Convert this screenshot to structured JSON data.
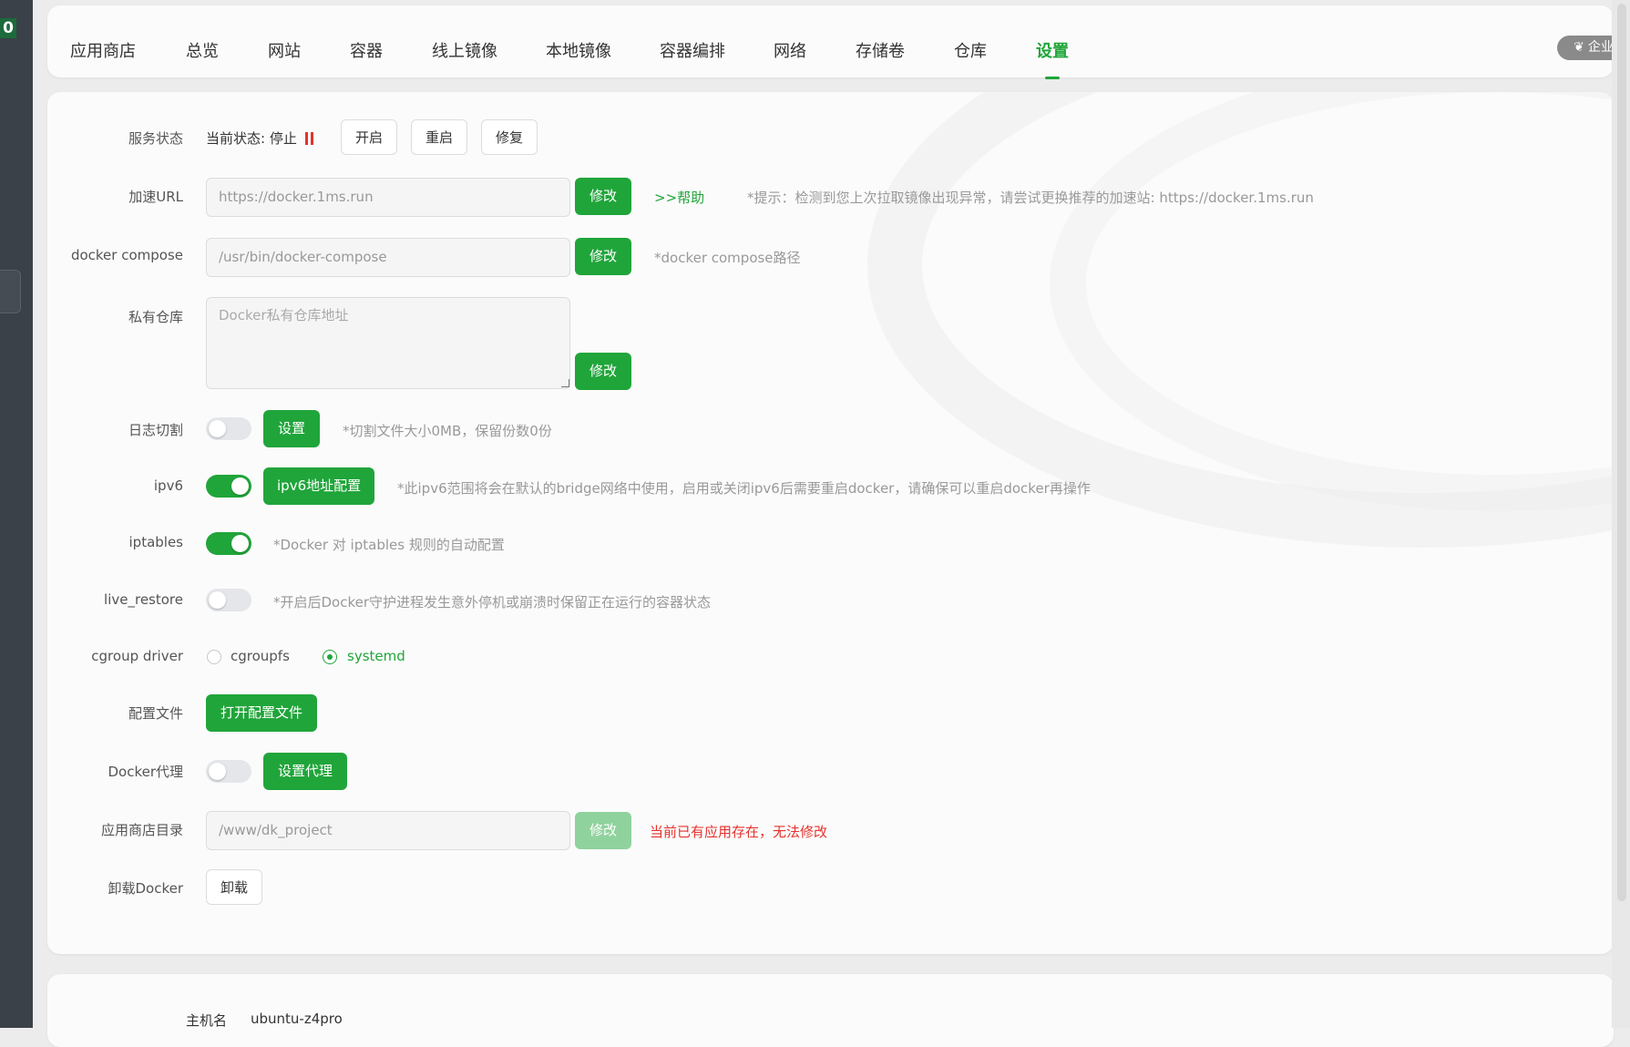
{
  "tabs": [
    "应用商店",
    "总览",
    "网站",
    "容器",
    "线上镜像",
    "本地镜像",
    "容器编排",
    "网络",
    "存储卷",
    "仓库",
    "设置"
  ],
  "enterprise_badge": "企业版",
  "rail_badge": "0",
  "service": {
    "label": "服务状态",
    "status_prefix": "当前状态:",
    "status_value": "停止",
    "buttons": [
      "开启",
      "重启",
      "修复"
    ]
  },
  "mirror_url": {
    "label": "加速URL",
    "value": "https://docker.1ms.run",
    "button": "修改",
    "help": ">>帮助",
    "hint": "*提示：检测到您上次拉取镜像出现异常，请尝试更换推荐的加速站: https://docker.1ms.run"
  },
  "compose": {
    "label": "docker compose",
    "value": "/usr/bin/docker-compose",
    "button": "修改",
    "hint": "*docker compose路径"
  },
  "registry": {
    "label": "私有仓库",
    "placeholder": "Docker私有仓库地址",
    "button": "修改"
  },
  "log_rotate": {
    "label": "日志切割",
    "enabled": false,
    "button": "设置",
    "hint": "*切割文件大小0MB，保留份数0份"
  },
  "ipv6": {
    "label": "ipv6",
    "enabled": true,
    "button": "ipv6地址配置",
    "hint": "*此ipv6范围将会在默认的bridge网络中使用，启用或关闭ipv6后需要重启docker，请确保可以重启docker再操作"
  },
  "iptables": {
    "label": "iptables",
    "enabled": true,
    "hint": "*Docker 对 iptables 规则的自动配置"
  },
  "live_restore": {
    "label": "live_restore",
    "enabled": false,
    "hint": "*开启后Docker守护进程发生意外停机或崩溃时保留正在运行的容器状态"
  },
  "cgroup": {
    "label": "cgroup driver",
    "options": [
      "cgroupfs",
      "systemd"
    ],
    "selected": "systemd"
  },
  "config_file": {
    "label": "配置文件",
    "button": "打开配置文件"
  },
  "proxy": {
    "label": "Docker代理",
    "enabled": false,
    "button": "设置代理"
  },
  "app_dir": {
    "label": "应用商店目录",
    "value": "/www/dk_project",
    "button": "修改",
    "hint": "当前已有应用存在，无法修改"
  },
  "uninstall": {
    "label": "卸载Docker",
    "button": "卸载"
  },
  "host": {
    "label": "主机名",
    "value": "ubuntu-z4pro"
  },
  "colors": {
    "accent": "#20a53a",
    "danger": "#e5322d",
    "accent_disabled": "#90d29d"
  }
}
